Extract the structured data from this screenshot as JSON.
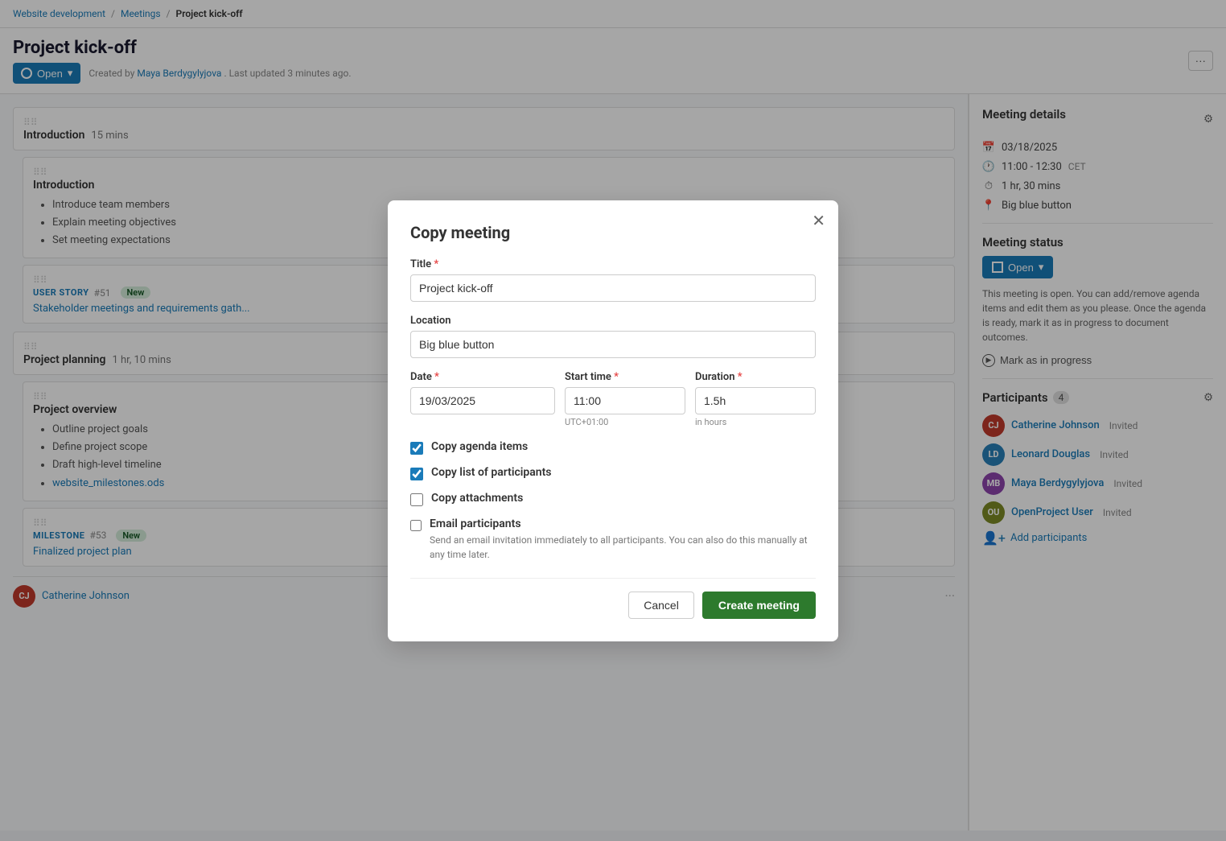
{
  "breadcrumb": {
    "part1": "Website development",
    "part2": "Meetings",
    "part3": "Project kick-off"
  },
  "page": {
    "title": "Project kick-off",
    "open_label": "Open",
    "meta_text": "Created by",
    "author": "Maya Berdygylyjova",
    "meta_suffix": ". Last updated 3 minutes ago."
  },
  "agenda": {
    "sections": [
      {
        "title": "Introduction",
        "duration": "15 mins",
        "type": "heading"
      },
      {
        "title": "Introduction",
        "type": "subheading",
        "items": [
          "Introduce team members",
          "Explain meeting objectives",
          "Set meeting expectations"
        ]
      },
      {
        "type": "userstory",
        "label": "USER STORY",
        "number": "#51",
        "tag": "New",
        "title": "Stakeholder meetings and requirements gath..."
      },
      {
        "title": "Project planning",
        "duration": "1 hr, 10 mins",
        "type": "heading"
      },
      {
        "title": "Project overview",
        "type": "subheading",
        "items": [
          "Outline project goals",
          "Define project scope",
          "Draft high-level timeline"
        ],
        "link": "website_milestones.ods"
      },
      {
        "type": "milestone",
        "label": "MILESTONE",
        "number": "#53",
        "tag": "New",
        "title": "Finalized project plan"
      }
    ]
  },
  "right_panel": {
    "meeting_details_title": "Meeting details",
    "date": "03/18/2025",
    "time": "11:00 - 12:30",
    "timezone": "CET",
    "duration": "1 hr, 30 mins",
    "location": "Big blue button",
    "meeting_status_title": "Meeting status",
    "open_btn_label": "Open",
    "status_desc": "This meeting is open. You can add/remove agenda items and edit them as you please. Once the agenda is ready, mark it as in progress to document outcomes.",
    "mark_progress_label": "Mark as in progress",
    "participants_title": "Participants",
    "participants_count": "4",
    "participants": [
      {
        "initials": "CJ",
        "name": "Catherine Johnson",
        "status": "Invited",
        "color": "#c0392b"
      },
      {
        "initials": "LD",
        "name": "Leonard Douglas",
        "status": "Invited",
        "color": "#2980b9"
      },
      {
        "initials": "MB",
        "name": "Maya Berdygylyjova",
        "status": "Invited",
        "color": "#8e44ad"
      },
      {
        "initials": "OU",
        "name": "OpenProject User",
        "status": "Invited",
        "color": "#7d8b26"
      }
    ],
    "add_participants_label": "Add participants"
  },
  "modal": {
    "title": "Copy meeting",
    "title_label": "Title",
    "title_required": "*",
    "title_value": "Project kick-off",
    "location_label": "Location",
    "location_value": "Big blue button",
    "date_label": "Date",
    "date_required": "*",
    "date_value": "19/03/2025",
    "start_time_label": "Start time",
    "start_time_required": "*",
    "start_time_value": "11:00",
    "start_time_sub": "UTC+01:00",
    "duration_label": "Duration",
    "duration_required": "*",
    "duration_value": "1.5h",
    "duration_sub": "in hours",
    "checkbox1_label": "Copy agenda items",
    "checkbox1_checked": true,
    "checkbox2_label": "Copy list of participants",
    "checkbox2_checked": true,
    "checkbox3_label": "Copy attachments",
    "checkbox3_checked": false,
    "checkbox4_label": "Email participants",
    "checkbox4_checked": false,
    "checkbox4_desc": "Send an email invitation immediately to all participants. You can also do this manually at any time later.",
    "cancel_label": "Cancel",
    "create_label": "Create meeting"
  },
  "bottom_bar": {
    "avatar_initials": "CJ",
    "avatar_color": "#c0392b",
    "participant_name": "Catherine Johnson",
    "more_label": "···"
  }
}
